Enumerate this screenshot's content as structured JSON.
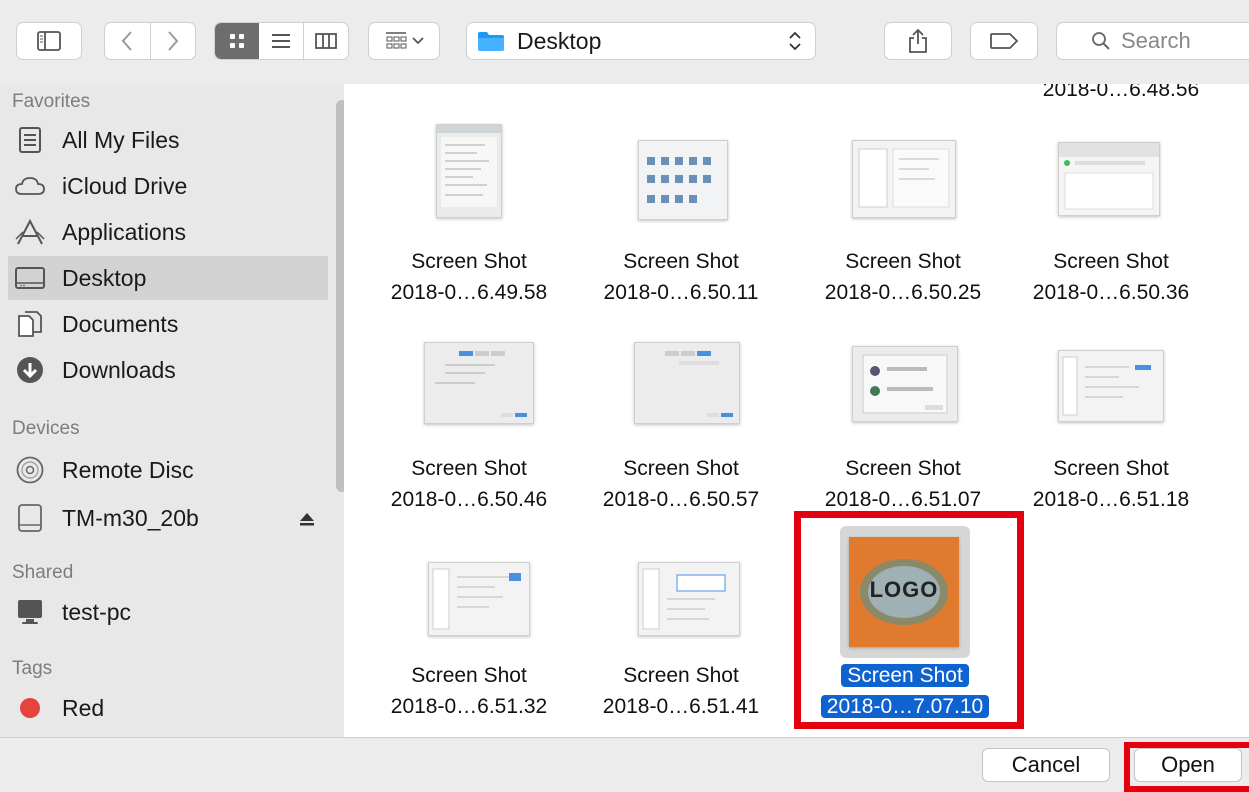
{
  "toolbar": {
    "location": "Desktop",
    "search_placeholder": "Search"
  },
  "sidebar": {
    "sections": [
      {
        "title": "Favorites",
        "items": [
          "All My Files",
          "iCloud Drive",
          "Applications",
          "Desktop",
          "Documents",
          "Downloads"
        ]
      },
      {
        "title": "Devices",
        "items": [
          "Remote Disc",
          "TM-m30_20b"
        ]
      },
      {
        "title": "Shared",
        "items": [
          "test-pc"
        ]
      },
      {
        "title": "Tags",
        "items": [
          "Red"
        ]
      }
    ],
    "selected": "Desktop",
    "tag_color": "#e5433b"
  },
  "files": {
    "partial_top": "2018-0…6.48.56",
    "items": [
      {
        "line1": "Screen Shot",
        "line2": "2018-0…6.49.58"
      },
      {
        "line1": "Screen Shot",
        "line2": "2018-0…6.50.11"
      },
      {
        "line1": "Screen Shot",
        "line2": "2018-0…6.50.25"
      },
      {
        "line1": "Screen Shot",
        "line2": "2018-0…6.50.36"
      },
      {
        "line1": "Screen Shot",
        "line2": "2018-0…6.50.46"
      },
      {
        "line1": "Screen Shot",
        "line2": "2018-0…6.50.57"
      },
      {
        "line1": "Screen Shot",
        "line2": "2018-0…6.51.07"
      },
      {
        "line1": "Screen Shot",
        "line2": "2018-0…6.51.18"
      },
      {
        "line1": "Screen Shot",
        "line2": "2018-0…6.51.32"
      },
      {
        "line1": "Screen Shot",
        "line2": "2018-0…6.51.41"
      },
      {
        "line1": "Screen Shot",
        "line2": "2018-0…7.07.10",
        "logo_text": "LOGO"
      }
    ]
  },
  "buttons": {
    "cancel": "Cancel",
    "open": "Open"
  },
  "colors": {
    "selection": "#0f63d0",
    "highlight_box": "#e4000f",
    "logo_bg": "#e07a2f"
  }
}
